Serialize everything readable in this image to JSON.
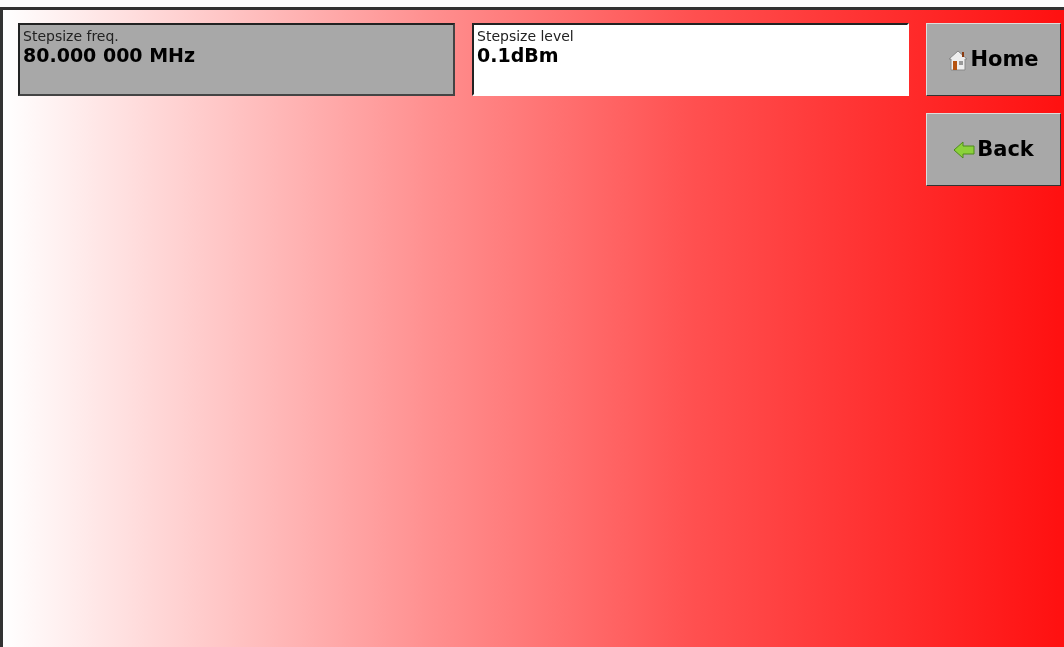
{
  "fields": [
    {
      "label": "Stepsize freq.",
      "value": "80.000 000 MHz",
      "selected": false
    },
    {
      "label": "Stepsize level",
      "value": "0.1dBm",
      "selected": true
    }
  ],
  "buttons": [
    {
      "kind": "home",
      "label": "Home"
    },
    {
      "kind": "back",
      "label": "Back"
    }
  ]
}
